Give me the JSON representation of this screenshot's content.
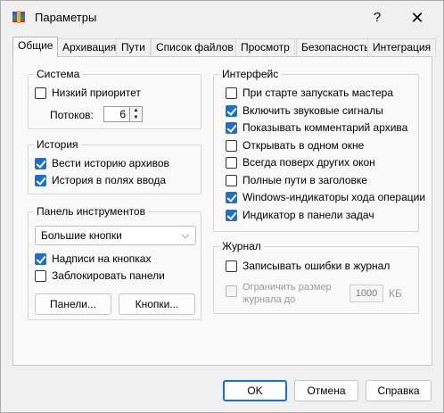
{
  "window": {
    "title": "Параметры",
    "help_glyph": "?",
    "close_glyph": "✕"
  },
  "tabs": [
    {
      "label": "Общие",
      "active": true
    },
    {
      "label": "Архивация",
      "active": false
    },
    {
      "label": "Пути",
      "active": false
    },
    {
      "label": "Список файлов",
      "active": false
    },
    {
      "label": "Просмотр",
      "active": false
    },
    {
      "label": "Безопасность",
      "active": false
    },
    {
      "label": "Интеграция",
      "active": false
    }
  ],
  "system": {
    "title": "Система",
    "low_priority": {
      "label": "Низкий приоритет",
      "checked": false
    },
    "threads_label": "Потоков:",
    "threads_value": "6"
  },
  "history": {
    "title": "История",
    "keep_archive_history": {
      "label": "Вести историю архивов",
      "checked": true
    },
    "input_history": {
      "label": "История в полях ввода",
      "checked": true
    }
  },
  "toolbar": {
    "title": "Панель инструментов",
    "button_size": "Большие кнопки",
    "captions": {
      "label": "Надписи на кнопках",
      "checked": true
    },
    "lock": {
      "label": "Заблокировать панели",
      "checked": false
    },
    "panels_button": "Панели...",
    "buttons_button": "Кнопки..."
  },
  "interface": {
    "title": "Интерфейс",
    "items": [
      {
        "label": "При старте запускать мастера",
        "checked": false
      },
      {
        "label": "Включить звуковые сигналы",
        "checked": true
      },
      {
        "label": "Показывать комментарий архива",
        "checked": true
      },
      {
        "label": "Открывать в одном окне",
        "checked": false
      },
      {
        "label": "Всегда поверх других окон",
        "checked": false
      },
      {
        "label": "Полные пути в заголовке",
        "checked": false
      },
      {
        "label": "Windows-индикаторы хода операции",
        "checked": true
      },
      {
        "label": "Индикатор в панели задач",
        "checked": true
      }
    ]
  },
  "log": {
    "title": "Журнал",
    "write_errors": {
      "label": "Записывать ошибки в журнал",
      "checked": false
    },
    "limit_size_line1": "Ограничить размер",
    "limit_size_line2": "журнала до",
    "limit_value": "1000",
    "limit_unit": "КБ"
  },
  "footer": {
    "ok": "OK",
    "cancel": "Отмена",
    "help": "Справка"
  },
  "colors": {
    "accent": "#1a6fd2"
  }
}
